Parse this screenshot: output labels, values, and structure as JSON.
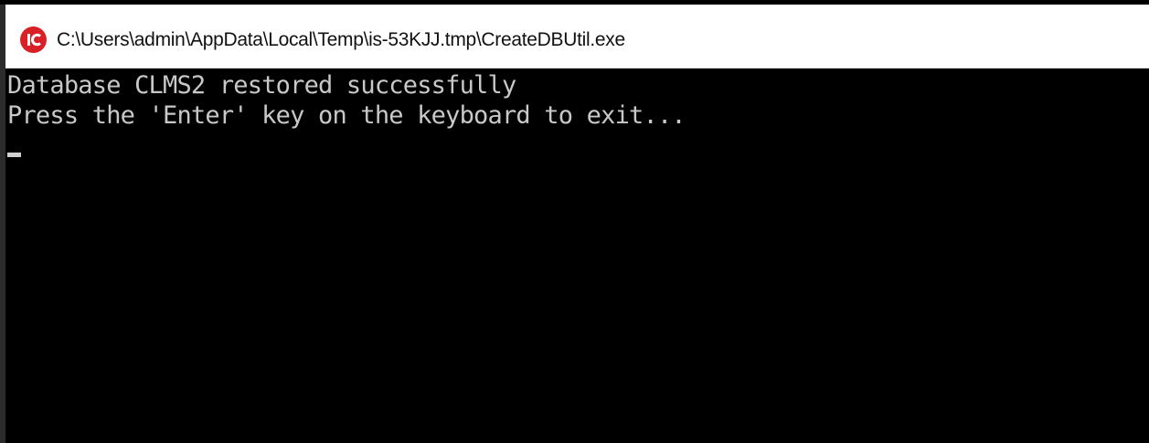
{
  "window": {
    "title": "C:\\Users\\admin\\AppData\\Local\\Temp\\is-53KJJ.tmp\\CreateDBUtil.exe",
    "icon": "app-logo-icon"
  },
  "console": {
    "lines": [
      "Database CLMS2 restored successfully",
      "Press the 'Enter' key on the keyboard to exit..."
    ]
  },
  "colors": {
    "console_background": "#000000",
    "console_text": "#c8c8c8",
    "titlebar_background": "#ffffff",
    "icon_accent": "#d92027"
  }
}
